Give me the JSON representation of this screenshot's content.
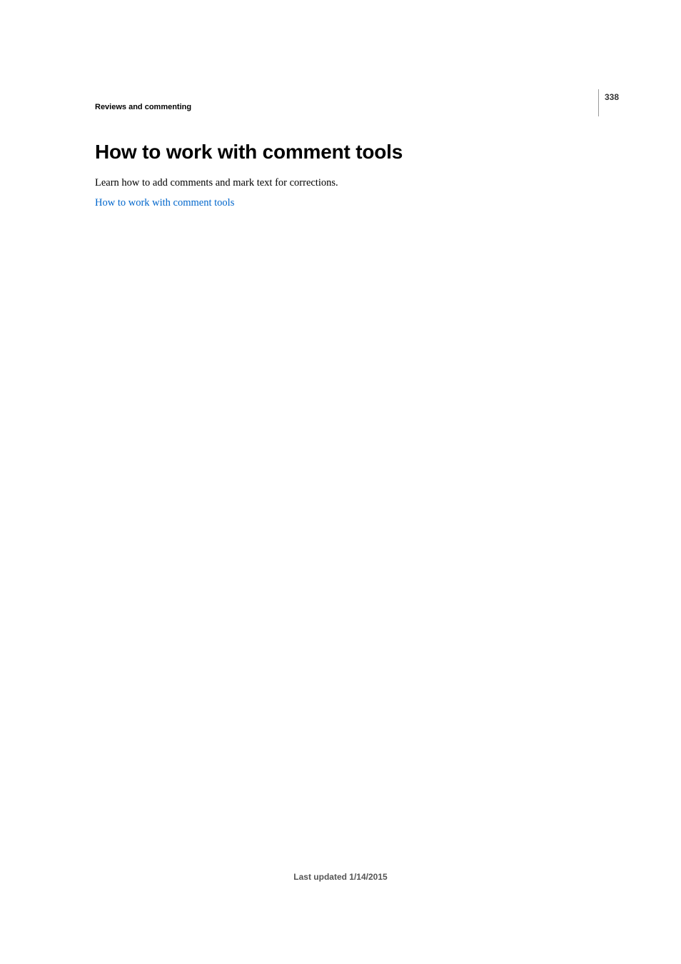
{
  "page_number": "338",
  "section_header": "Reviews and commenting",
  "title": "How to work with comment tools",
  "body": "Learn how to add comments and mark text for corrections.",
  "link_text": "How to work with comment tools",
  "footer": "Last updated 1/14/2015"
}
